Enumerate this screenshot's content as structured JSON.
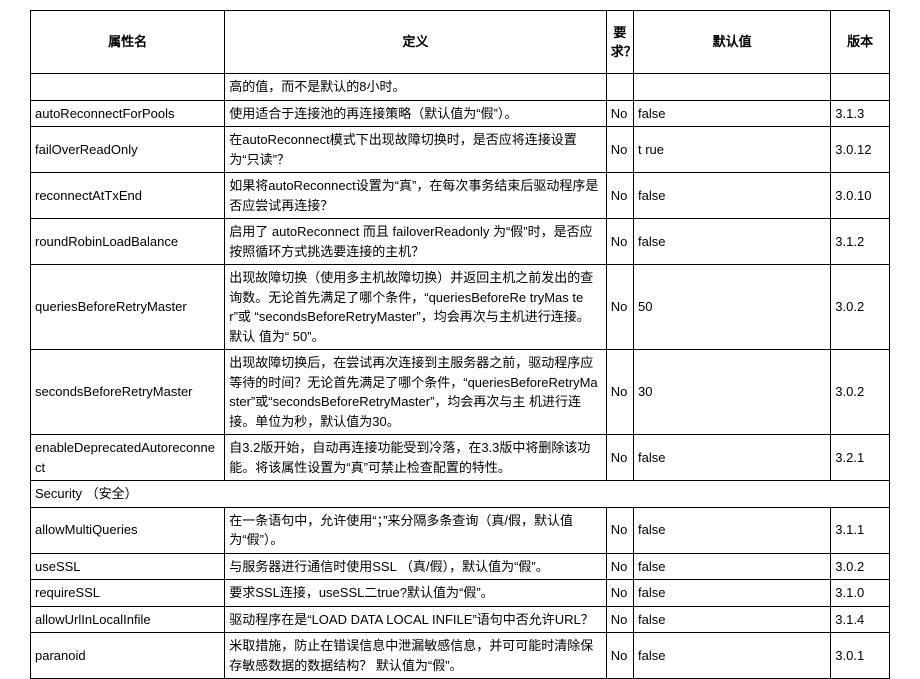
{
  "headers": {
    "name": "属性名",
    "definition": "定义",
    "required": "要求？",
    "default": "默认值",
    "version": "版本"
  },
  "rows": [
    {
      "name": "",
      "definition": "高的值，而不是默认的8小时。",
      "required": "",
      "default": "",
      "version": ""
    },
    {
      "name": "autoReconnectForPools",
      "definition": "使用适合于连接池的再连接策略（默认值为“假”）。",
      "required": "No",
      "default": "false",
      "version": "3.1.3"
    },
    {
      "name": "failOverReadOnly",
      "definition": "在autoReconnect模式下出现故障切换时，是否应将连接设置为“只读”？",
      "required": "No",
      "default": "t rue",
      "version": "3.0.12"
    },
    {
      "name": "reconnectAtTxEnd",
      "definition": "如果将autoReconnect设置为“真”，在每次事务结束后驱动程序是否应尝试再连接？",
      "required": "No",
      "default": "false",
      "version": "3.0.10"
    },
    {
      "name": "roundRobinLoadBalance",
      "definition": "启用了 autoReconnect 而且 failoverReadonly 为“假”时，是否应按照循环方式挑选要连接的主机？",
      "required": "No",
      "default": "false",
      "version": "3.1.2"
    },
    {
      "name": "queriesBeforeRetryMaster",
      "definition": "出现故障切换（使用多主机故障切换）并返回主机之前发出的查询数。无论首先满足了哪个条件，“queriesBeforeRe tryMas ter”或 “secondsBeforeRetryMaster”，均会再次与主机进行连接。默认 值为“ 50”。",
      "required": "No",
      "default": "50",
      "version": "3.0.2"
    },
    {
      "name": "secondsBeforeRetryMaster",
      "definition": "出现故障切换后，在尝试再次连接到主服务器之前，驱动程序应等待的时间？无论首先满足了哪个条件，“queriesBeforeRetryMaster”或“secondsBeforeRetryMaster”，均会再次与主 机进行连接。单位为秒，默认值为30。",
      "required": "No",
      "default": "30",
      "version": "3.0.2"
    },
    {
      "name": "enableDeprecatedAutoreconnect",
      "definition": "自3.2版开始，自动再连接功能受到冷落，在3.3版中将删除该功能。将该属性设置为“真”可禁止检查配置的特性。",
      "required": "No",
      "default": "false",
      "version": "3.2.1"
    }
  ],
  "section": "Security （安全）",
  "rows2": [
    {
      "name": "allowMultiQueries",
      "definition": "在一条语句中，允许使用“；”来分隔多条查询（真/假，默认值为“假”）。",
      "required": "No",
      "default": "false",
      "version": "3.1.1"
    },
    {
      "name": "useSSL",
      "definition": "与服务器进行通信时使用SSL （真/假），默认值为“假”。",
      "required": "No",
      "default": "false",
      "version": "3.0.2"
    },
    {
      "name": "requireSSL",
      "definition": "要求SSL连接，useSSL二true?默认值为“假”。",
      "required": "No",
      "default": "false",
      "version": "3.1.0"
    },
    {
      "name": "allowUrlInLocalInfile",
      "definition": "驱动程序在是“LOAD DATA LOCAL INFILE”语句中否允许URL？",
      "required": "No",
      "default": "false",
      "version": "3.1.4"
    },
    {
      "name": "paranoid",
      "definition": "米取措施，防止在错误信息中泄漏敏感信息，并可可能时清除保存敏感数据的数据结构？ 默认值为“假”。",
      "required": "No",
      "default": "false",
      "version": "3.0.1"
    }
  ]
}
